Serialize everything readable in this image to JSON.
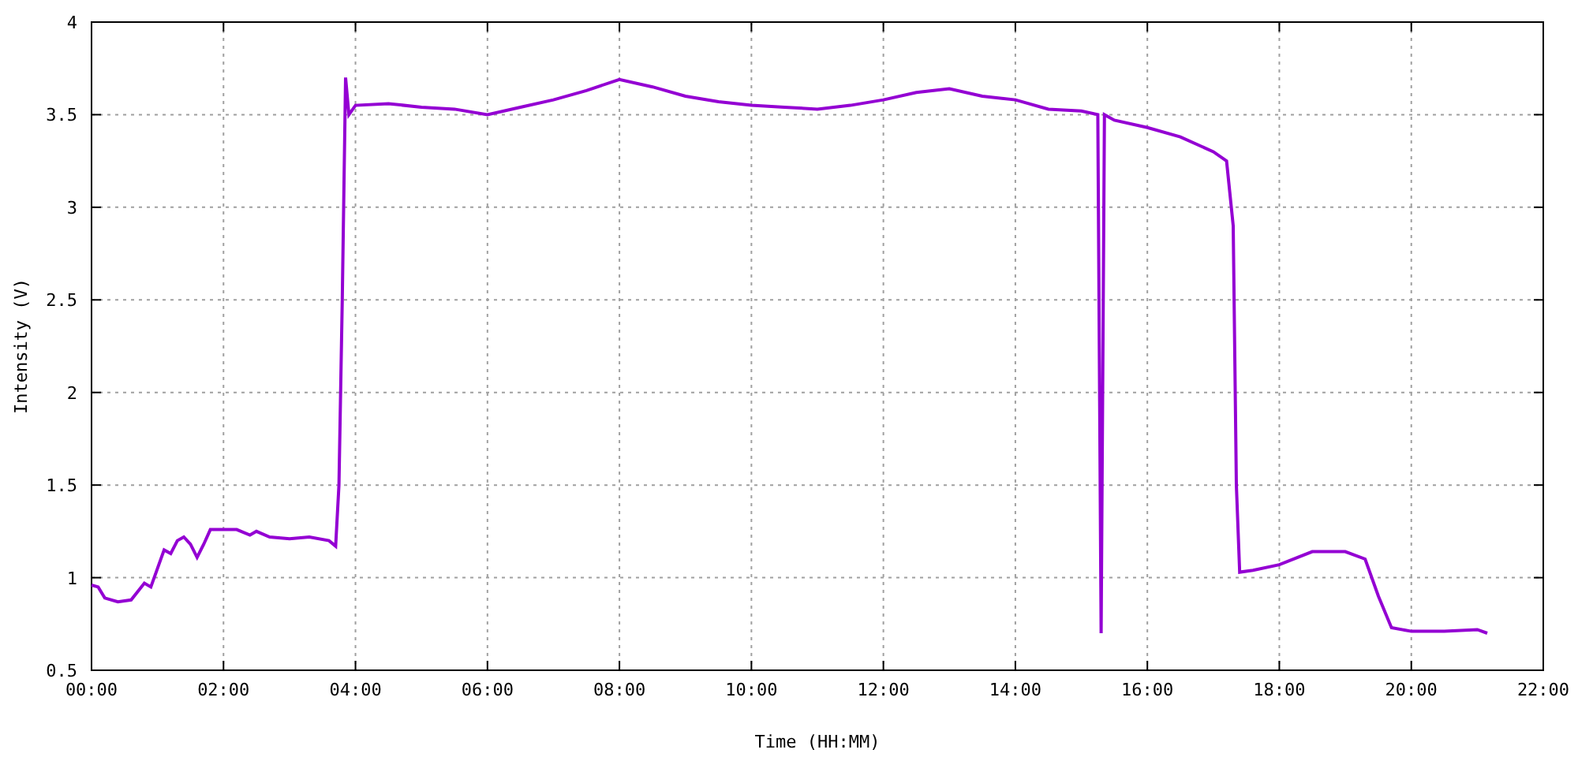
{
  "chart_data": {
    "type": "line",
    "grid": true,
    "xlabel": "Time (HH:MM)",
    "ylabel": "Intensity (V)",
    "xlim": [
      0,
      22
    ],
    "ylim": [
      0.5,
      4
    ],
    "xticks": [
      {
        "value": 0,
        "label": "00:00"
      },
      {
        "value": 2,
        "label": "02:00"
      },
      {
        "value": 4,
        "label": "04:00"
      },
      {
        "value": 6,
        "label": "06:00"
      },
      {
        "value": 8,
        "label": "08:00"
      },
      {
        "value": 10,
        "label": "10:00"
      },
      {
        "value": 12,
        "label": "12:00"
      },
      {
        "value": 14,
        "label": "14:00"
      },
      {
        "value": 16,
        "label": "16:00"
      },
      {
        "value": 18,
        "label": "18:00"
      },
      {
        "value": 20,
        "label": "20:00"
      },
      {
        "value": 22,
        "label": "22:00"
      }
    ],
    "yticks": [
      {
        "value": 0.5,
        "label": "0.5"
      },
      {
        "value": 1,
        "label": "1"
      },
      {
        "value": 1.5,
        "label": "1.5"
      },
      {
        "value": 2,
        "label": "2"
      },
      {
        "value": 2.5,
        "label": "2.5"
      },
      {
        "value": 3,
        "label": "3"
      },
      {
        "value": 3.5,
        "label": "3.5"
      },
      {
        "value": 4,
        "label": "4"
      }
    ],
    "x": [
      0,
      0.1,
      0.2,
      0.4,
      0.6,
      0.8,
      0.9,
      1.0,
      1.1,
      1.2,
      1.3,
      1.4,
      1.5,
      1.6,
      1.7,
      1.8,
      2.0,
      2.2,
      2.4,
      2.5,
      2.7,
      3.0,
      3.3,
      3.6,
      3.7,
      3.75,
      3.8,
      3.85,
      3.9,
      4.0,
      4.5,
      5.0,
      5.5,
      6.0,
      6.5,
      7.0,
      7.5,
      8.0,
      8.5,
      9.0,
      9.5,
      10.0,
      10.5,
      11.0,
      11.5,
      12.0,
      12.5,
      13.0,
      13.5,
      14.0,
      14.5,
      15.0,
      15.25,
      15.3,
      15.35,
      15.5,
      16.0,
      16.5,
      17.0,
      17.2,
      17.3,
      17.35,
      17.4,
      17.6,
      18.0,
      18.5,
      19.0,
      19.3,
      19.5,
      19.7,
      20.0,
      20.5,
      21.0,
      21.15
    ],
    "series": [
      {
        "color": "#9400d3",
        "values": [
          0.96,
          0.95,
          0.89,
          0.87,
          0.88,
          0.97,
          0.95,
          1.05,
          1.15,
          1.13,
          1.2,
          1.22,
          1.18,
          1.11,
          1.18,
          1.26,
          1.26,
          1.26,
          1.23,
          1.25,
          1.22,
          1.21,
          1.22,
          1.2,
          1.17,
          1.5,
          2.5,
          3.7,
          3.5,
          3.55,
          3.56,
          3.54,
          3.53,
          3.5,
          3.54,
          3.58,
          3.63,
          3.69,
          3.65,
          3.6,
          3.57,
          3.55,
          3.54,
          3.53,
          3.55,
          3.58,
          3.62,
          3.64,
          3.6,
          3.58,
          3.53,
          3.52,
          3.5,
          0.7,
          3.5,
          3.47,
          3.43,
          3.38,
          3.3,
          3.25,
          2.9,
          1.5,
          1.03,
          1.04,
          1.07,
          1.14,
          1.14,
          1.1,
          0.9,
          0.73,
          0.71,
          0.71,
          0.72,
          0.7
        ]
      }
    ]
  }
}
